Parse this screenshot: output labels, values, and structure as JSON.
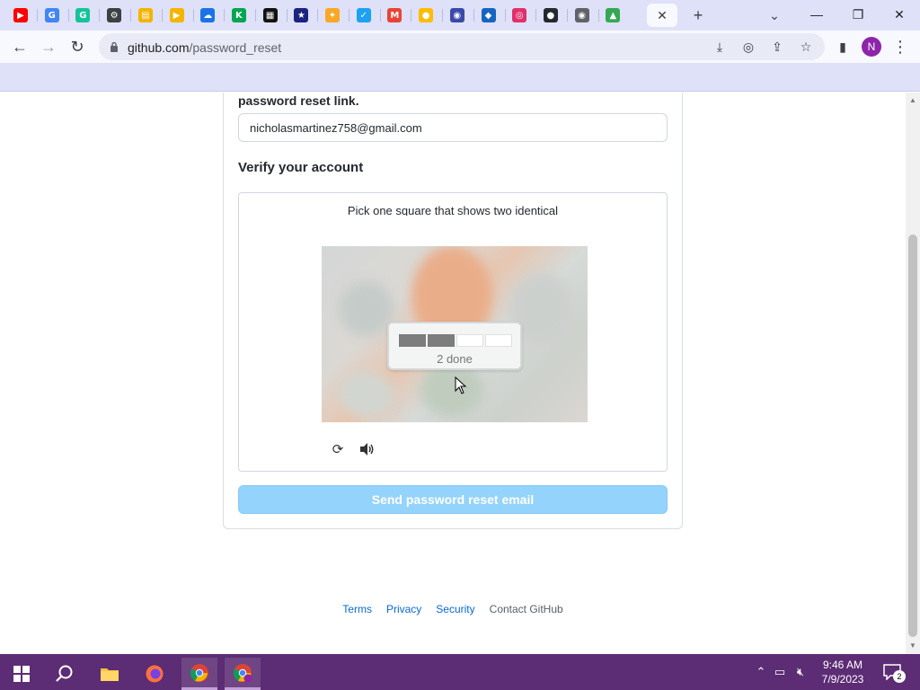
{
  "browser": {
    "tabs": [
      {
        "icon": "youtube-icon",
        "color": "#ff0000"
      },
      {
        "icon": "google-icon",
        "color": "#4285f4"
      },
      {
        "icon": "grammarly-icon",
        "color": "#15c39a"
      },
      {
        "icon": "settings-gear-icon",
        "color": "#3c4043"
      },
      {
        "icon": "folder-icon",
        "color": "#f4b400"
      },
      {
        "icon": "folder-video-icon",
        "color": "#f4b400"
      },
      {
        "icon": "cloud-app-icon",
        "color": "#1a73e8"
      },
      {
        "icon": "kim-icon",
        "color": "#00a651"
      },
      {
        "icon": "qr-game-icon",
        "color": "#111111"
      },
      {
        "icon": "space-game-icon",
        "color": "#1a237e"
      },
      {
        "icon": "compass-icon",
        "color": "#f9a825"
      },
      {
        "icon": "twitter-icon",
        "color": "#1da1f2"
      },
      {
        "icon": "gmail-icon",
        "color": "#ea4335"
      },
      {
        "icon": "lightbulb-icon",
        "color": "#fbbc04"
      },
      {
        "icon": "logo-circle-icon",
        "color": "#3949ab"
      },
      {
        "icon": "sonic-icon",
        "color": "#1565c0"
      },
      {
        "icon": "instagram-icon",
        "color": "#e1306c"
      },
      {
        "icon": "github-icon",
        "color": "#24292f"
      },
      {
        "icon": "chrome-icon",
        "color": "#5f6368"
      },
      {
        "icon": "google-drive-icon",
        "color": "#34a853"
      }
    ],
    "close_tab": "✕",
    "new_tab": "+",
    "url_host": "github.com",
    "url_path": "/password_reset",
    "profile_initial": "N"
  },
  "page": {
    "instruction": "password reset link.",
    "email_value": "nicholasmartinez758@gmail.com",
    "verify_title": "Verify your account",
    "captcha_prompt": "Pick one square that shows two identical",
    "progress_label": "2 done",
    "progress": {
      "done": 2,
      "total": 4
    },
    "submit_label": "Send password reset email"
  },
  "footer": {
    "links": [
      "Terms",
      "Privacy",
      "Security",
      "Contact GitHub"
    ]
  },
  "taskbar": {
    "time": "9:46 AM",
    "date": "7/9/2023",
    "notification_count": "2"
  },
  "colors": {
    "accent_blue": "#0969da",
    "button_disabled": "#94d3fc",
    "taskbar": "#5c2c74"
  }
}
